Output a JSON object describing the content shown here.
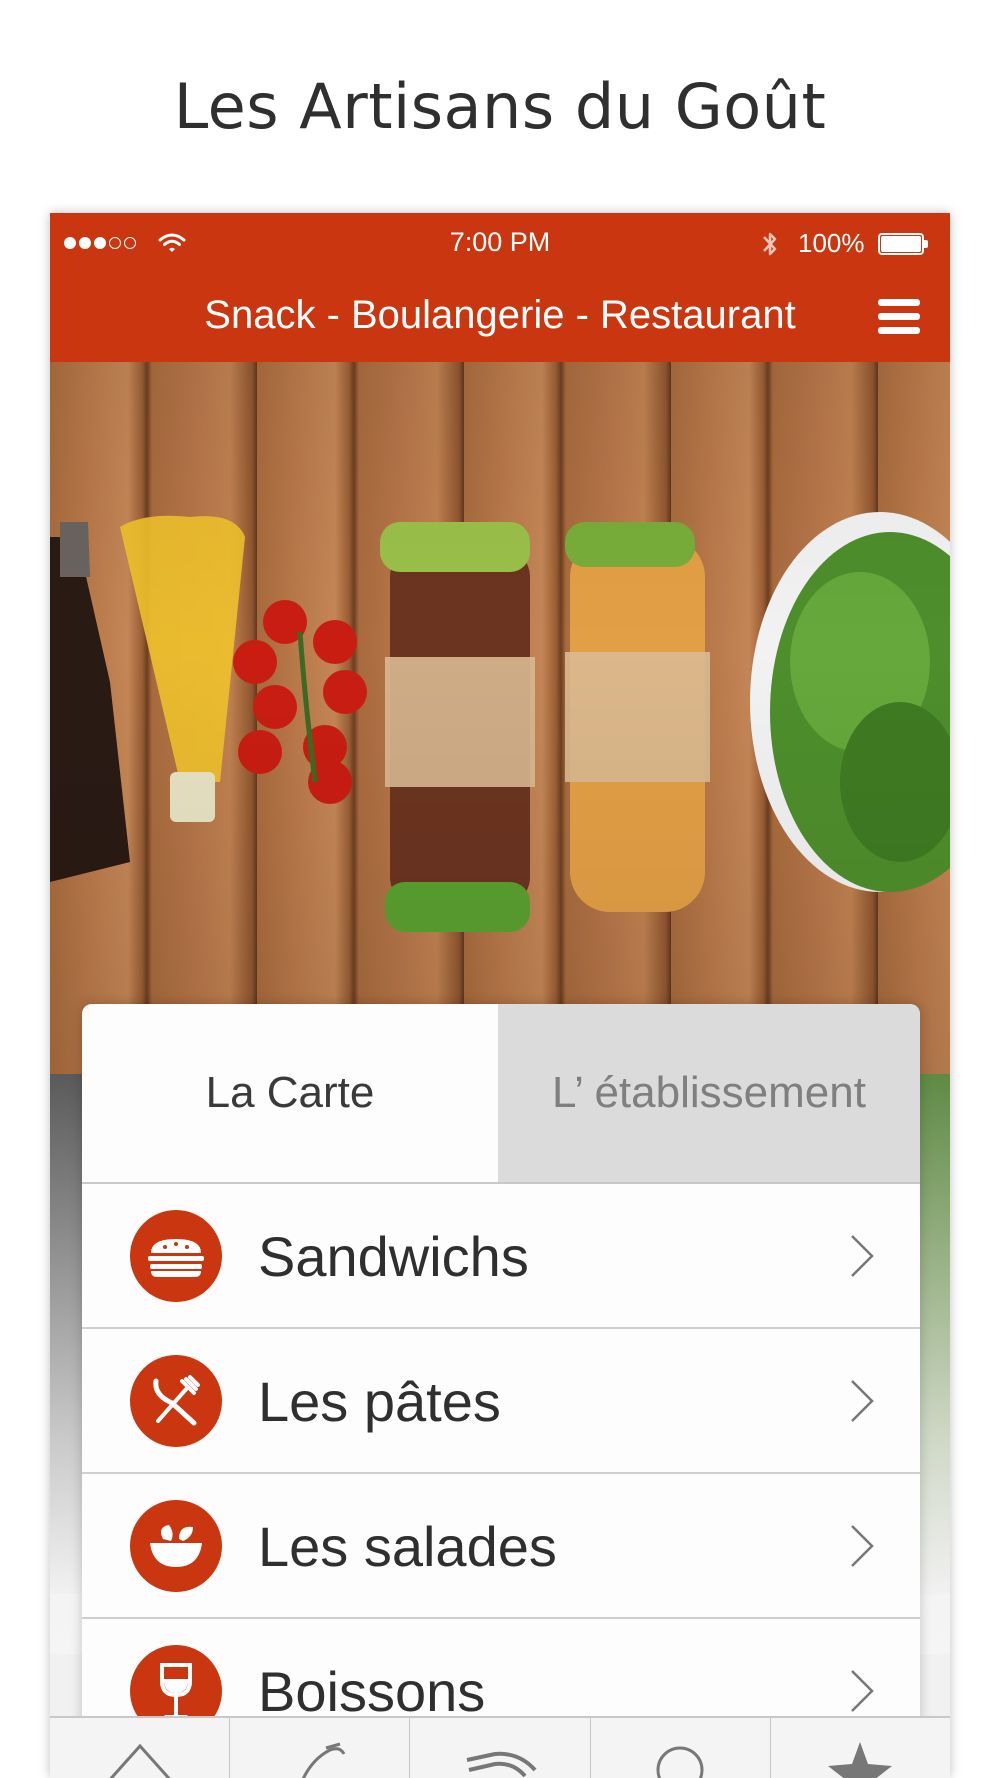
{
  "promo": {
    "title": "Les Artisans du Goût"
  },
  "status_bar": {
    "time": "7:00 PM",
    "battery": "100%",
    "battery_level": 1.0,
    "signal_bars_filled": 3,
    "signal_bars_total": 5,
    "icons": [
      "wifi-icon",
      "bluetooth-icon",
      "battery-icon"
    ]
  },
  "navbar": {
    "title": "Snack - Boulangerie - Restaurant",
    "menu_icon": "hamburger-menu-icon"
  },
  "tabs": [
    {
      "label": "La Carte",
      "active": true
    },
    {
      "label": "L’ établissement",
      "active": false
    }
  ],
  "menu": [
    {
      "label": "Sandwichs",
      "icon": "sandwich-icon"
    },
    {
      "label": "Les pâtes",
      "icon": "fork-knife-icon"
    },
    {
      "label": "Les salades",
      "icon": "salad-bowl-icon"
    },
    {
      "label": "Boissons",
      "icon": "wine-glass-icon"
    }
  ],
  "tab_bar": {
    "items": [
      "home-icon",
      "phone-icon",
      "map-icon",
      "search-icon",
      "star-icon"
    ]
  },
  "colors": {
    "accent": "#c9360f",
    "tab_inactive": "#dcdbdb"
  }
}
